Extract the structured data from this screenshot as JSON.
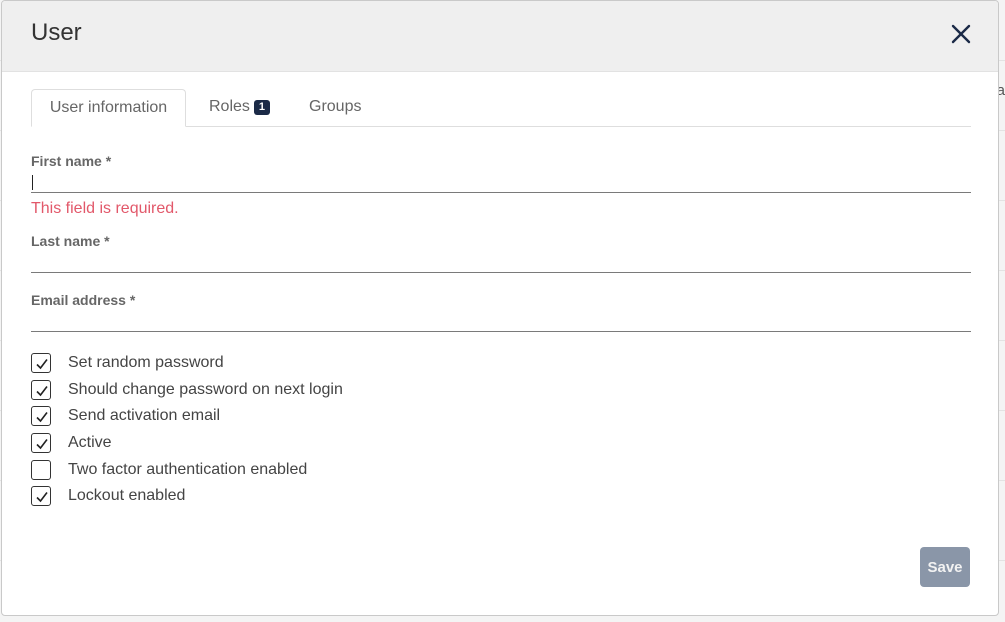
{
  "modal": {
    "title": "User",
    "close_icon": "close-icon"
  },
  "background": {
    "visible_text": "a"
  },
  "tabs": [
    {
      "label": "User information",
      "active": true
    },
    {
      "label": "Roles",
      "badge": "1",
      "active": false
    },
    {
      "label": "Groups",
      "active": false
    }
  ],
  "fields": {
    "first_name": {
      "label": "First name *",
      "value": "",
      "error": "This field is required."
    },
    "last_name": {
      "label": "Last name *",
      "value": ""
    },
    "email": {
      "label": "Email address *",
      "value": ""
    }
  },
  "checkboxes": [
    {
      "label": "Set random password",
      "checked": true
    },
    {
      "label": "Should change password on next login",
      "checked": true
    },
    {
      "label": "Send activation email",
      "checked": true
    },
    {
      "label": "Active",
      "checked": true
    },
    {
      "label": "Two factor authentication enabled",
      "checked": false
    },
    {
      "label": "Lockout enabled",
      "checked": true
    }
  ],
  "footer": {
    "save_label": "Save",
    "save_disabled": true
  },
  "colors": {
    "error": "#e2586a",
    "badge": "#1b2a47",
    "save_button": "#8a96a8",
    "header_bg": "#efefef"
  }
}
